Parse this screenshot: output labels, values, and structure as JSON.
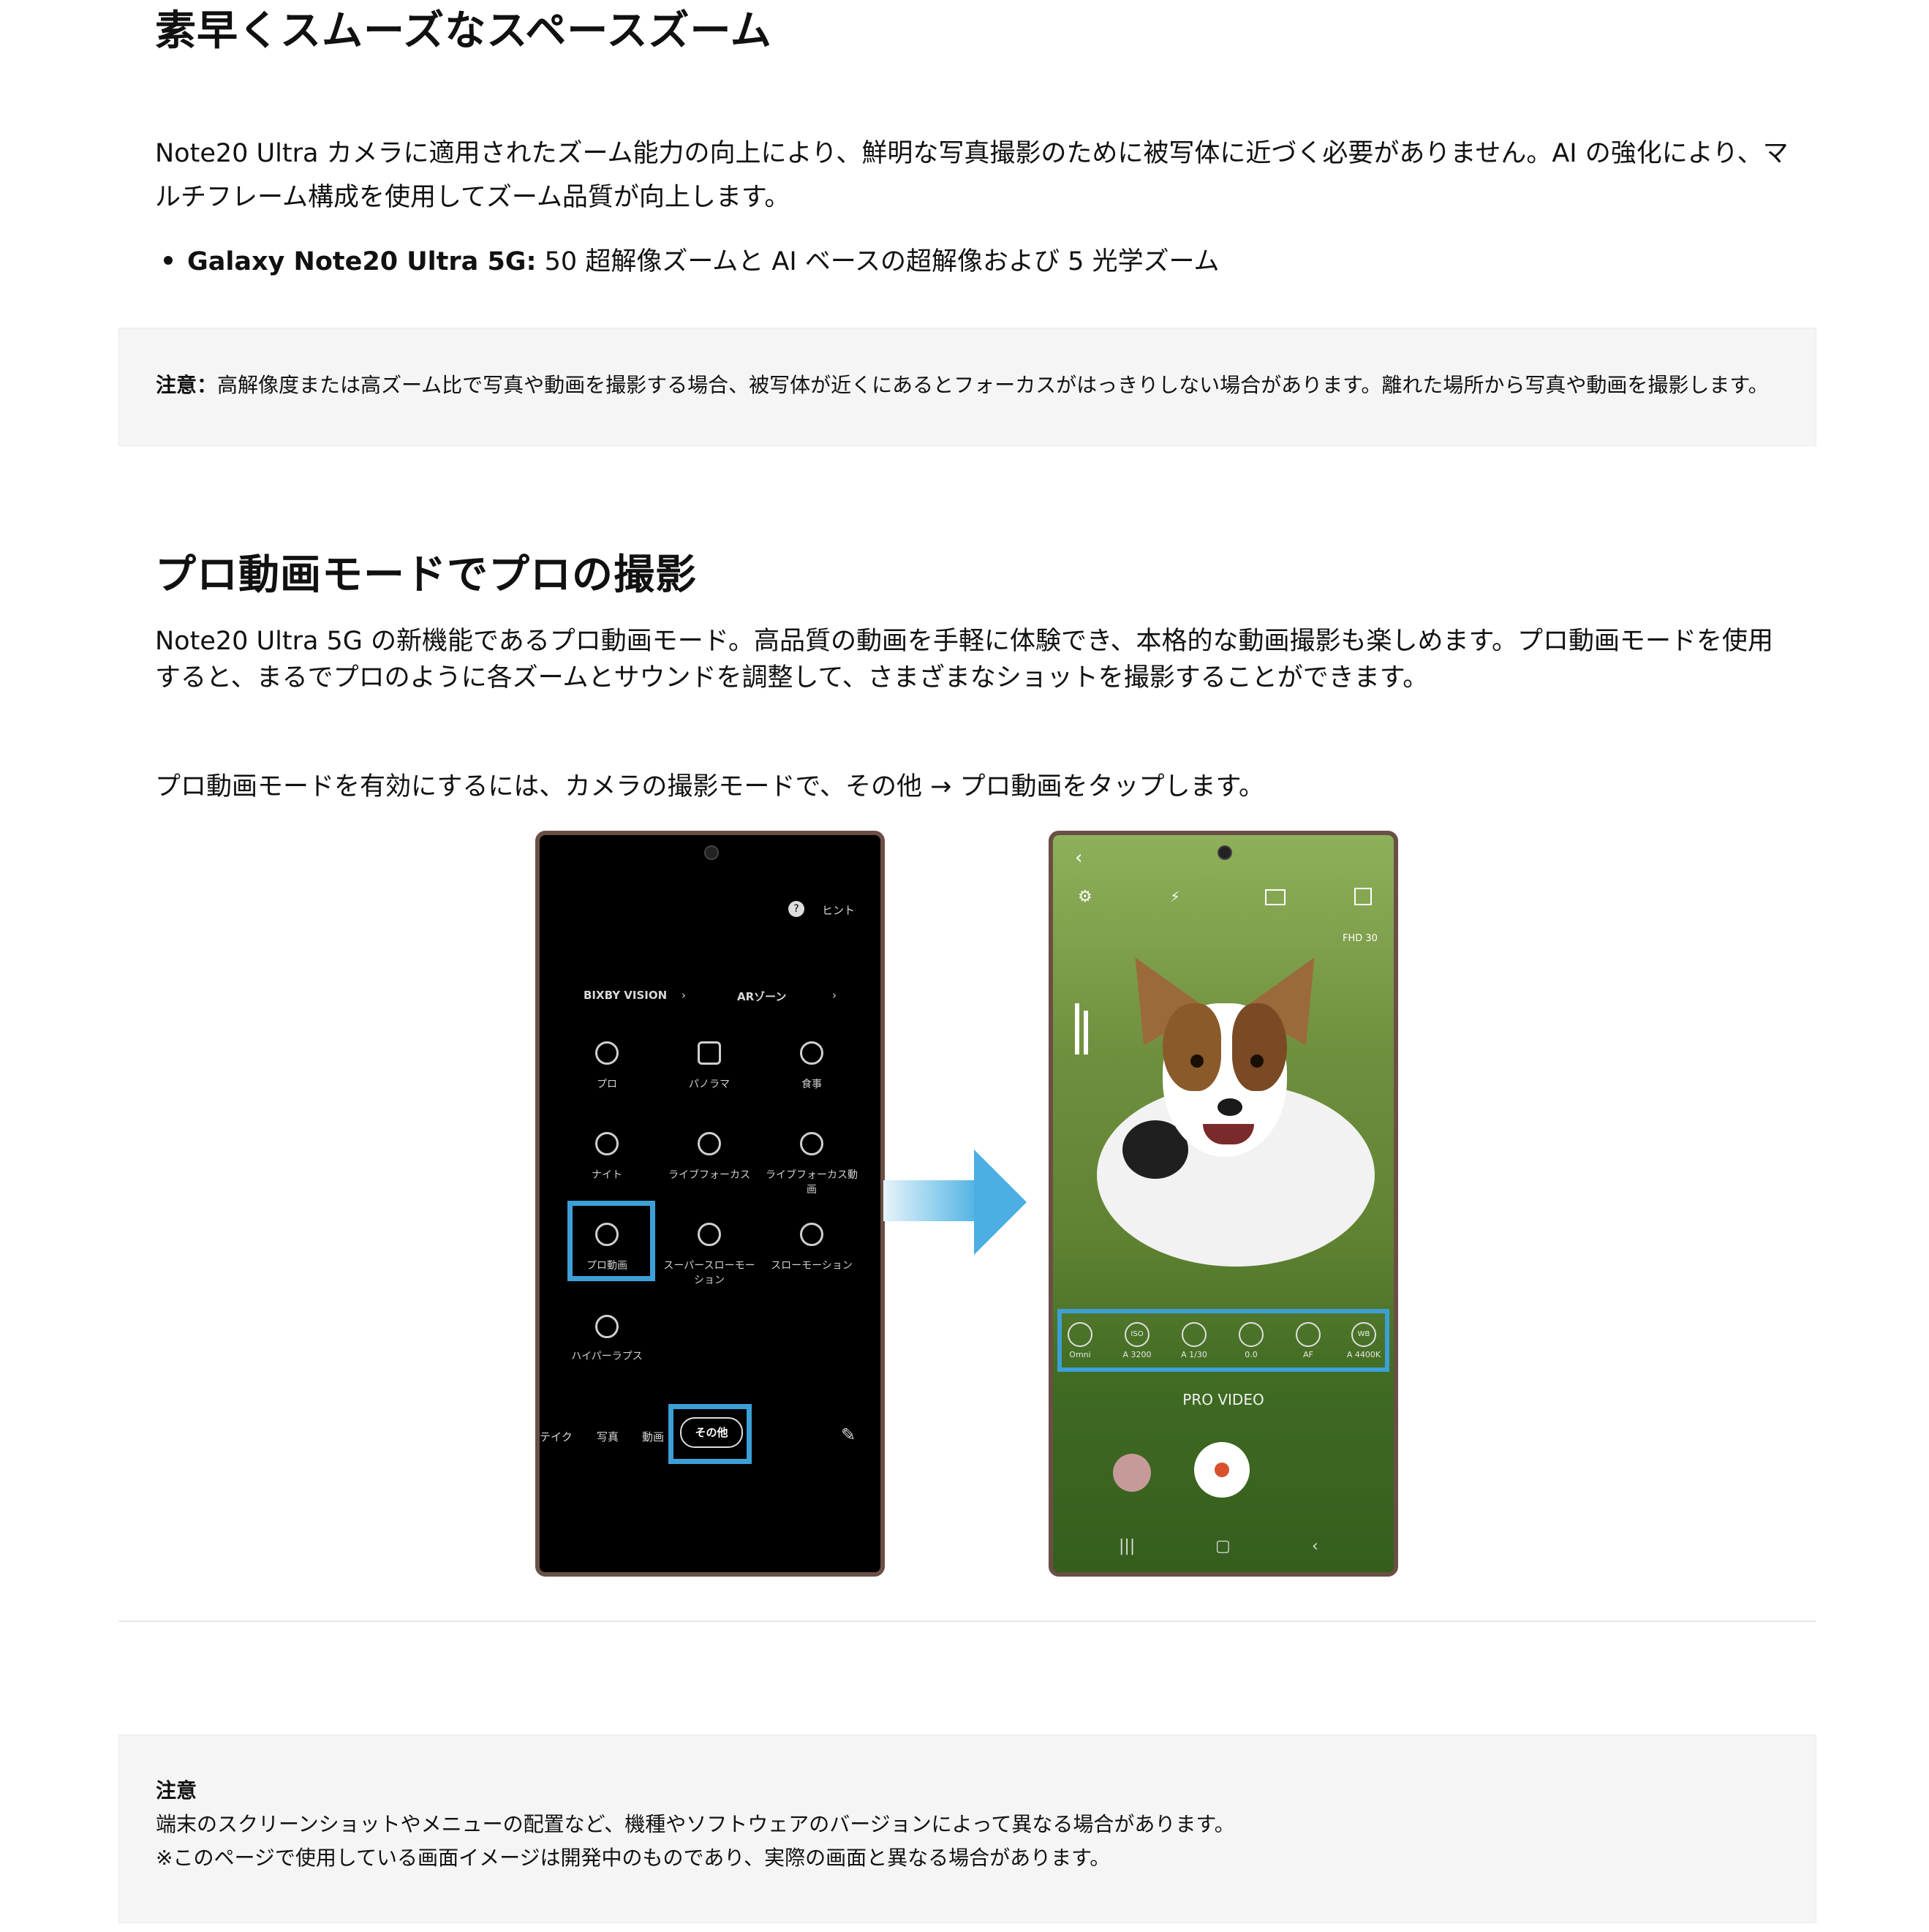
{
  "section1": {
    "title": "素早くスムーズなスペースズーム",
    "paragraph": "Note20 Ultra カメラに適用されたズーム能力の向上により、鮮明な写真撮影のために被写体に近づく必要がありません。AI の強化により、マルチフレーム構成を使用してズーム品質が向上します。",
    "bullet_label": "Galaxy Note20 Ultra 5G:",
    "bullet_text": " 50 超解像ズームと AI ベースの超解像および 5 光学ズーム"
  },
  "note1": {
    "label": "注意：",
    "text": "高解像度または高ズーム比で写真や動画を撮影する場合、被写体が近くにあるとフォーカスがはっきりしない場合があります。離れた場所から写真や動画を撮影します。"
  },
  "section2": {
    "title": "プロ動画モードでプロの撮影",
    "paragraph1": "Note20 Ultra 5G の新機能であるプロ動画モード。高品質の動画を手軽に体験でき、本格的な動画撮影も楽しめます。プロ動画モードを使用すると、まるでプロのように各ズームとサウンドを調整して、さまざまなショットを撮影することができます。",
    "paragraph2": "プロ動画モードを有効にするには、カメラの撮影モードで、その他 → プロ動画をタップします。"
  },
  "phone1": {
    "hint": "ヒント",
    "bixby": "BIXBY VISION",
    "ar": "ARゾーン",
    "modes": [
      "プロ",
      "パノラマ",
      "食事",
      "ナイト",
      "ライブフォーカス",
      "ライブフォーカス動画",
      "プロ動画",
      "スーパースローモーション",
      "スローモーション",
      "ハイパーラプス"
    ],
    "tabs": [
      "テイク",
      "写真",
      "動画",
      "その他"
    ]
  },
  "phone2": {
    "fhd": "FHD 30",
    "controls": [
      "Omni",
      "A 3200",
      "A 1/30",
      "0.0",
      "AF",
      "A 4400K"
    ],
    "control_icons": [
      "",
      "ISO",
      "",
      "",
      "",
      "WB"
    ],
    "mode_label": "PRO VIDEO"
  },
  "note2": {
    "label": "注意",
    "line1": "端末のスクリーンショットやメニューの配置など、機種やソフトウェアのバージョンによって異なる場合があります。",
    "line2": "※このページで使用している画面イメージは開発中のものであり、実際の画面と異なる場合があります。"
  },
  "colors": {
    "highlight": "#3ca0d6",
    "note_bg": "#f5f5f5",
    "record": "#d9502f"
  }
}
